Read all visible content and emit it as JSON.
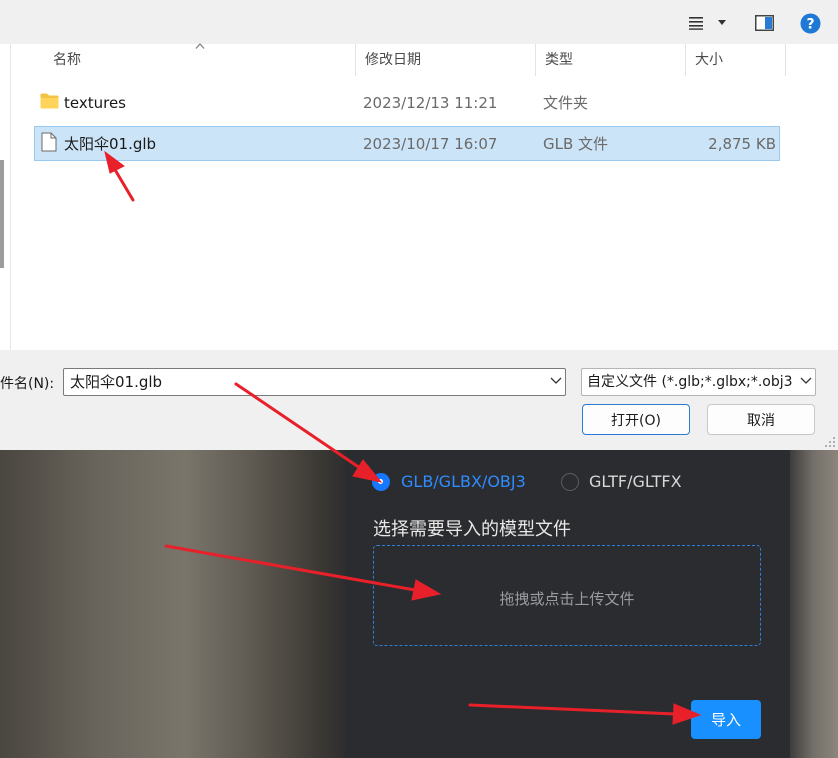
{
  "dialog": {
    "columns": {
      "name": "名称",
      "date": "修改日期",
      "type": "类型",
      "size": "大小"
    },
    "files": [
      {
        "name": "textures",
        "date": "2023/12/13 11:21",
        "type": "文件夹",
        "size": "",
        "kind": "folder-icon",
        "selected": false
      },
      {
        "name": "太阳伞01.glb",
        "date": "2023/10/17 16:07",
        "type": "GLB 文件",
        "size": "2,875 KB",
        "kind": "file-icon",
        "selected": true
      }
    ],
    "filename_label": "件名(N):",
    "filename_value": "太阳伞01.glb",
    "filetype_value": "自定义文件 (*.glb;*.glbx;*.obj3",
    "open_label": "打开(O)",
    "cancel_label": "取消",
    "toolbar_icons": [
      "view-menu-icon",
      "preview-pane-icon",
      "help-icon"
    ],
    "accent_color": "#0078d4"
  },
  "import_panel": {
    "format_options": [
      {
        "label": "GLB/GLBX/OBJ3",
        "selected": true
      },
      {
        "label": "GLTF/GLTFX",
        "selected": false
      }
    ],
    "section_title": "选择需要导入的模型文件",
    "drop_zone_text": "拖拽或点击上传文件",
    "import_button_label": "导入",
    "accent_color": "#1890ff"
  },
  "annotation_color": "#e8202a"
}
